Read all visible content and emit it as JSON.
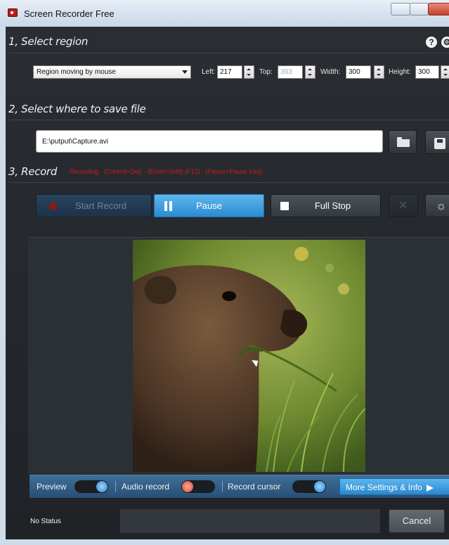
{
  "window": {
    "title": "Screen Recorder Free"
  },
  "section1": {
    "title": "1, Select region"
  },
  "region": {
    "mode": "Region moving by mouse",
    "left_label": "Left:",
    "left_value": "217",
    "top_label": "Top:",
    "top_value": "393",
    "width_label": "Width:",
    "width_value": "300",
    "height_label": "Height:",
    "height_value": "300"
  },
  "section2": {
    "title": "2, Select where to save file"
  },
  "save": {
    "path": "E:\\putput\\Capture.avi"
  },
  "section3": {
    "title": "3, Record",
    "status": "Recording  ·  (Control+Del) · (Enter+Shift) (F12) · (Pause+Pause Key)"
  },
  "buttons": {
    "start": "Start Record",
    "pause": "Pause",
    "stop": "Full Stop",
    "cancel": "Cancel"
  },
  "options": {
    "preview_label": "Preview",
    "audio_label": "Audio record",
    "cursor_label": "Record cursor",
    "more_label": "More Settings & Info"
  },
  "status_bar": {
    "text": "No Status"
  },
  "icons": {
    "help": "?",
    "settings": "⚙",
    "tools": "✕",
    "sun": "☼"
  },
  "colors": {
    "accent_blue": "#2a8cd2",
    "record_red": "#d11818"
  }
}
